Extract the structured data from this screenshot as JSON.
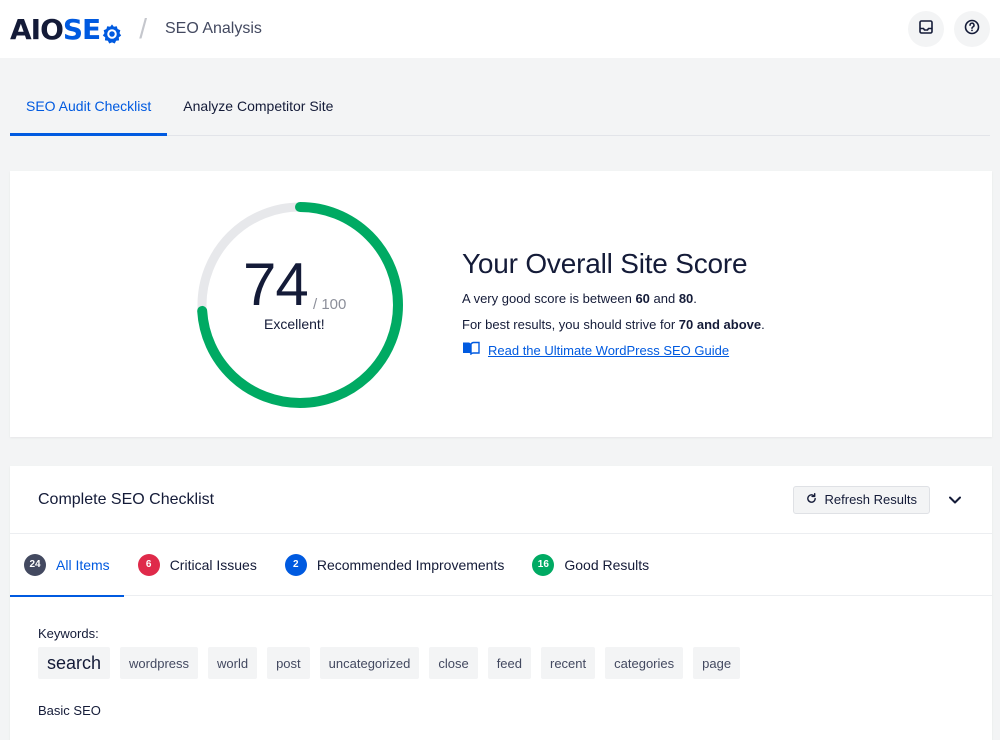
{
  "header": {
    "logo_aio": "AIO",
    "logo_seo": "SE",
    "title": "SEO Analysis"
  },
  "main_tabs": [
    {
      "label": "SEO Audit Checklist",
      "active": true
    },
    {
      "label": "Analyze Competitor Site",
      "active": false
    }
  ],
  "score": {
    "value": "74",
    "max": "/ 100",
    "fraction": 0.74,
    "rating": "Excellent!",
    "heading": "Your Overall Site Score",
    "line1_prefix": "A very good score is between ",
    "line1_bold1": "60",
    "line1_and": " and ",
    "line1_bold2": "80",
    "line1_suffix": ".",
    "line2_prefix": "For best results, you should strive for ",
    "line2_bold": "70 and above",
    "line2_suffix": ".",
    "guide_link": "Read the Ultimate WordPress SEO Guide"
  },
  "checklist": {
    "title": "Complete SEO Checklist",
    "refresh_label": "Refresh Results",
    "filters": [
      {
        "count": "24",
        "label": "All Items",
        "color": "#434960",
        "active": true
      },
      {
        "count": "6",
        "label": "Critical Issues",
        "color": "#df2a4a",
        "active": false
      },
      {
        "count": "2",
        "label": "Recommended Improvements",
        "color": "#005ae0",
        "active": false
      },
      {
        "count": "16",
        "label": "Good Results",
        "color": "#00aa63",
        "active": false
      }
    ],
    "keywords_label": "Keywords:",
    "keywords": [
      "search",
      "wordpress",
      "world",
      "post",
      "uncategorized",
      "close",
      "feed",
      "recent",
      "categories",
      "page"
    ],
    "basic_seo_label": "Basic SEO"
  },
  "colors": {
    "accent": "#005ae0",
    "score_good": "#00aa63",
    "critical": "#df2a4a"
  }
}
